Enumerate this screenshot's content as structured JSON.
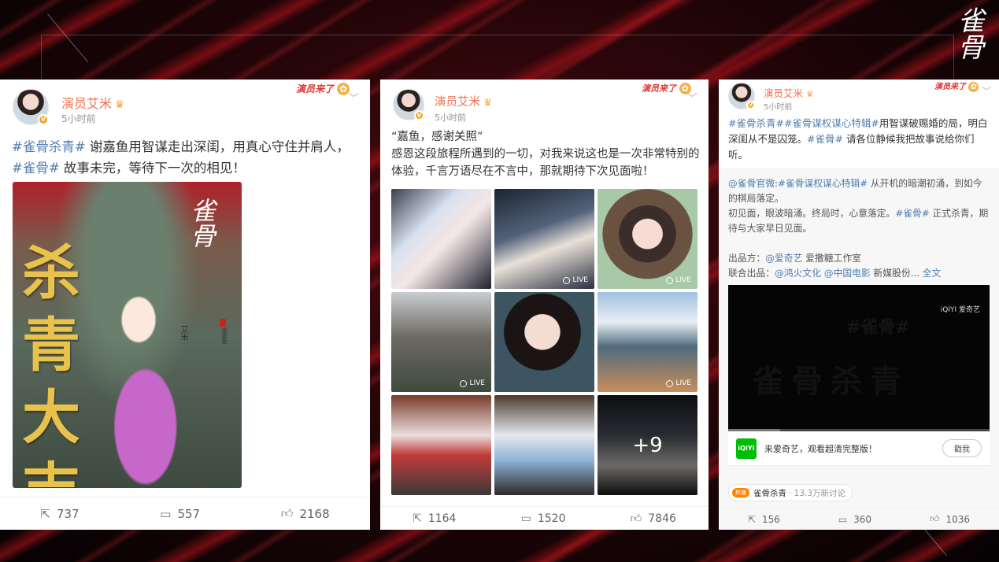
{
  "logo_text": "雀骨",
  "posts": [
    {
      "author": "演员艾米",
      "time": "5小时前",
      "sticker": "演员来了",
      "text_tag1": "#雀骨杀青#",
      "text_body1": " 谢嘉鱼用智谋走出深闺，用真心守住并肩人，",
      "text_tag2": "#雀骨#",
      "text_body2": " 故事未完，等待下一次的相见！",
      "poster": {
        "title": "杀青大吉",
        "logo": "雀骨",
        "actor": "艾米",
        "role": "谢嘉鱼"
      },
      "stats": {
        "reposts": "737",
        "comments": "557",
        "likes": "2168"
      }
    },
    {
      "author": "演员艾米",
      "time": "5小时前",
      "sticker": "演员来了",
      "line1": "“嘉鱼，感谢关照”",
      "line2": "感恩这段旅程所遇到的一切，对我来说这也是一次非常特别的体验，千言万语尽在不言中，那就期待下次见面啦！",
      "live_label": "LIVE",
      "more_count": "+9",
      "stats": {
        "reposts": "1164",
        "comments": "1520",
        "likes": "7846"
      }
    },
    {
      "author": "演员艾米",
      "time": "5小时前",
      "sticker": "演员来了",
      "tag1": "#雀骨杀青#",
      "tag2": "#雀骨谋权谋心特辑#",
      "body1": "用智谋破赐婚的局，明白深闺从不是囚笼。",
      "tag3": "#雀骨#",
      "body2": " 请各位静候我把故事说给你们听。",
      "repost": {
        "mention": "@雀骨官微",
        "colon": ":",
        "tag1": "#雀骨谋权谋心特辑#",
        "body1": " 从开机的暗潮初涌，到如今的棋局落定。",
        "body2": "初见面，眼波暗涌。终局时，心意落定。",
        "tag2": "#雀骨#",
        "body3": " 正式杀青，期待与大家早日见面。",
        "producer_label": "出品方：",
        "producer1": "@爱奇艺",
        "producer2": " 爱撒糖工作室",
        "coproducer_label": "联合出品：",
        "coproducer1": "@鸿火文化",
        "coproducer2": "@中国电影",
        "coproducer3": " 新媒股份...",
        "full_text": " 全文",
        "video_watermark": "iQIYI 爱奇艺",
        "promo_logo": "iQIYI",
        "promo_text": "来爱奇艺，观看超清完整版！",
        "promo_button": "戳我"
      },
      "topic": {
        "badge": "热搜",
        "name": "雀骨杀青",
        "count": "· 13.3万新讨论"
      },
      "stats": {
        "reposts": "156",
        "comments": "360",
        "likes": "1036"
      }
    }
  ],
  "colors": {
    "accent_name": "#eb7350",
    "tag": "#507daf",
    "bg_red": "#b0101c"
  }
}
